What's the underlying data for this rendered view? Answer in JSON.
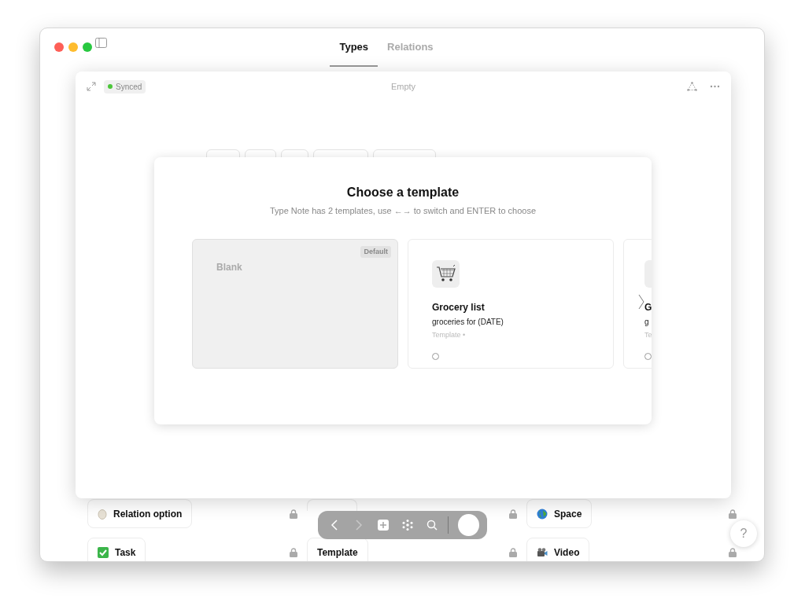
{
  "tabs": [
    {
      "label": "Types",
      "selected": true
    },
    {
      "label": "Relations",
      "selected": false
    }
  ],
  "types": [
    {
      "kind": "egg",
      "name": "Relation option",
      "locked": true
    },
    {
      "kind": "hidden",
      "locked": true
    },
    {
      "kind": "globe",
      "name": "Space",
      "locked": true
    },
    {
      "kind": "check",
      "name": "Task",
      "locked": true
    },
    {
      "kind": "none",
      "name": "Template",
      "locked": true
    },
    {
      "kind": "camera",
      "name": "Video",
      "locked": true
    }
  ],
  "panel": {
    "status": "Synced",
    "title": "Empty"
  },
  "modal": {
    "title": "Choose a template",
    "subtitle": "Type Note has 2 templates, use ←→ to switch and ENTER to choose",
    "templates": [
      {
        "kind": "blank",
        "name": "Blank",
        "badge": "Default",
        "selected": true
      },
      {
        "kind": "template",
        "name": "Grocery list",
        "description": "groceries for (DATE)",
        "meta": "Template •",
        "selected": false
      },
      {
        "kind": "template",
        "name": "G",
        "description": "g",
        "meta": "Te",
        "selected": false
      }
    ]
  },
  "toolbar": [
    {
      "kind": "back",
      "disabled": false
    },
    {
      "kind": "forward",
      "disabled": true
    },
    {
      "kind": "add",
      "disabled": false
    },
    {
      "kind": "graph",
      "disabled": false
    },
    {
      "kind": "search",
      "disabled": false
    }
  ],
  "help": "?"
}
